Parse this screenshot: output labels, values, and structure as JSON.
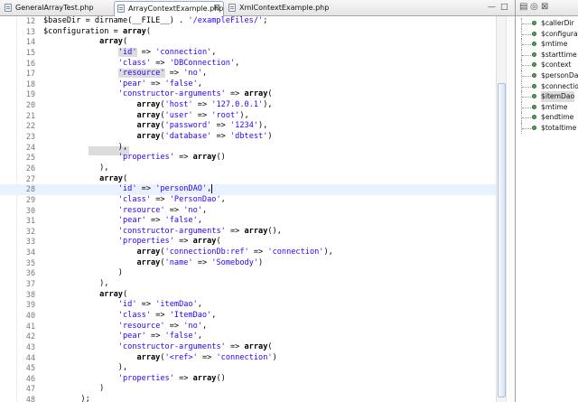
{
  "tabs": [
    {
      "label": "GeneralArrayTest.php",
      "active": false
    },
    {
      "label": "ArrayContextExample.php",
      "active": true,
      "close": "⊠"
    },
    {
      "label": "XmlContextExample.php",
      "active": false
    }
  ],
  "tab_controls": {
    "minimize": "—",
    "maximize": "□",
    "outline_close": "⊠"
  },
  "outline": {
    "items": [
      "$callerDir",
      "$configuration",
      "$mtime",
      "$starttime",
      "$context",
      "$personDao",
      "$connection",
      "$itemDao",
      "$mtime",
      "$endtime",
      "$totaltime"
    ],
    "selected_index": 7
  },
  "editor": {
    "current_line": 28,
    "lines": [
      {
        "n": "12",
        "code": "$baseDir = dirname(__FILE__) . '/exampleFiles/';"
      },
      {
        "n": "13",
        "code": "$configuration = array("
      },
      {
        "n": "14",
        "code": "            array("
      },
      {
        "n": "15",
        "code": "                'id' => 'connection',"
      },
      {
        "n": "16",
        "code": "                'class' => 'DBConnection',"
      },
      {
        "n": "17",
        "code": "                'resource' => 'no',"
      },
      {
        "n": "18",
        "code": "                'pear' => 'false',"
      },
      {
        "n": "19",
        "code": "                'constructor-arguments' => array("
      },
      {
        "n": "20",
        "code": "                    array('host' => '127.0.0.1'),"
      },
      {
        "n": "21",
        "code": "                    array('user' => 'root'),"
      },
      {
        "n": "22",
        "code": "                    array('password' => '1234'),"
      },
      {
        "n": "23",
        "code": "                    array('database' => 'dbtest')"
      },
      {
        "n": "24",
        "code": "                ),"
      },
      {
        "n": "25",
        "code": "                'properties' => array()"
      },
      {
        "n": "26",
        "code": "            ),"
      },
      {
        "n": "27",
        "code": "            array("
      },
      {
        "n": "28",
        "code": "                'id' => 'personDAO',"
      },
      {
        "n": "29",
        "code": "                'class' => 'PersonDao',"
      },
      {
        "n": "30",
        "code": "                'resource' => 'no',"
      },
      {
        "n": "31",
        "code": "                'pear' => 'false',"
      },
      {
        "n": "32",
        "code": "                'constructor-arguments' => array(),"
      },
      {
        "n": "33",
        "code": "                'properties' => array("
      },
      {
        "n": "34",
        "code": "                    array('connectionDb:ref' => 'connection'),"
      },
      {
        "n": "35",
        "code": "                    array('name' => 'Somebody')"
      },
      {
        "n": "36",
        "code": "                )"
      },
      {
        "n": "37",
        "code": "            ),"
      },
      {
        "n": "38",
        "code": "            array("
      },
      {
        "n": "39",
        "code": "                'id' => 'itemDao',"
      },
      {
        "n": "40",
        "code": "                'class' => 'ItemDao',"
      },
      {
        "n": "41",
        "code": "                'resource' => 'no',"
      },
      {
        "n": "42",
        "code": "                'pear' => 'false',"
      },
      {
        "n": "43",
        "code": "                'constructor-arguments' => array("
      },
      {
        "n": "44",
        "code": "                    array('<ref>' => 'connection')"
      },
      {
        "n": "45",
        "code": "                ),"
      },
      {
        "n": "46",
        "code": "                'properties' => array()"
      },
      {
        "n": "47",
        "code": "            )"
      },
      {
        "n": "48",
        "code": "        );"
      }
    ]
  },
  "colors": {
    "keyword": "#000000",
    "string": "#2a00ff",
    "current_line": "#e8f2fe",
    "line_number": "#787878"
  }
}
